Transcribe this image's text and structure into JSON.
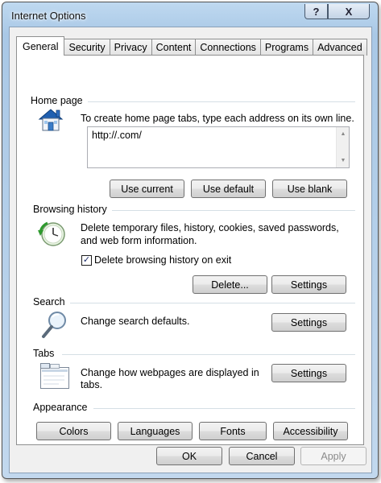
{
  "window": {
    "title": "Internet Options",
    "help_glyph": "?",
    "close_glyph": "X"
  },
  "tabs": [
    {
      "label": "General",
      "active": true
    },
    {
      "label": "Security"
    },
    {
      "label": "Privacy"
    },
    {
      "label": "Content"
    },
    {
      "label": "Connections"
    },
    {
      "label": "Programs"
    },
    {
      "label": "Advanced"
    }
  ],
  "home_page": {
    "heading": "Home page",
    "description": "To create home page tabs, type each address on its own line.",
    "url_value": "http://.com/",
    "use_current": "Use current",
    "use_default": "Use default",
    "use_blank": "Use blank"
  },
  "browsing_history": {
    "heading": "Browsing history",
    "description_line1": "Delete temporary files, history, cookies, saved passwords,",
    "description_line2": "and web form information.",
    "delete_on_exit_label": "Delete browsing history on exit",
    "delete_on_exit_checked": true,
    "check_glyph": "✓",
    "delete_button": "Delete...",
    "settings_button": "Settings"
  },
  "search": {
    "heading": "Search",
    "description": "Change search defaults.",
    "settings_button": "Settings"
  },
  "tabs_section": {
    "heading": "Tabs",
    "description_line1": "Change how webpages are displayed in",
    "description_line2": "tabs.",
    "settings_button": "Settings"
  },
  "appearance": {
    "heading": "Appearance",
    "colors": "Colors",
    "languages": "Languages",
    "fonts": "Fonts",
    "accessibility": "Accessibility"
  },
  "footer": {
    "ok": "OK",
    "cancel": "Cancel",
    "apply": "Apply",
    "apply_enabled": false
  },
  "icons": {
    "home": "home-icon",
    "history": "history-clock-icon",
    "search": "magnifier-icon",
    "tabs": "tabs-window-icon",
    "scroll_up": "▲",
    "scroll_down": "▼"
  }
}
